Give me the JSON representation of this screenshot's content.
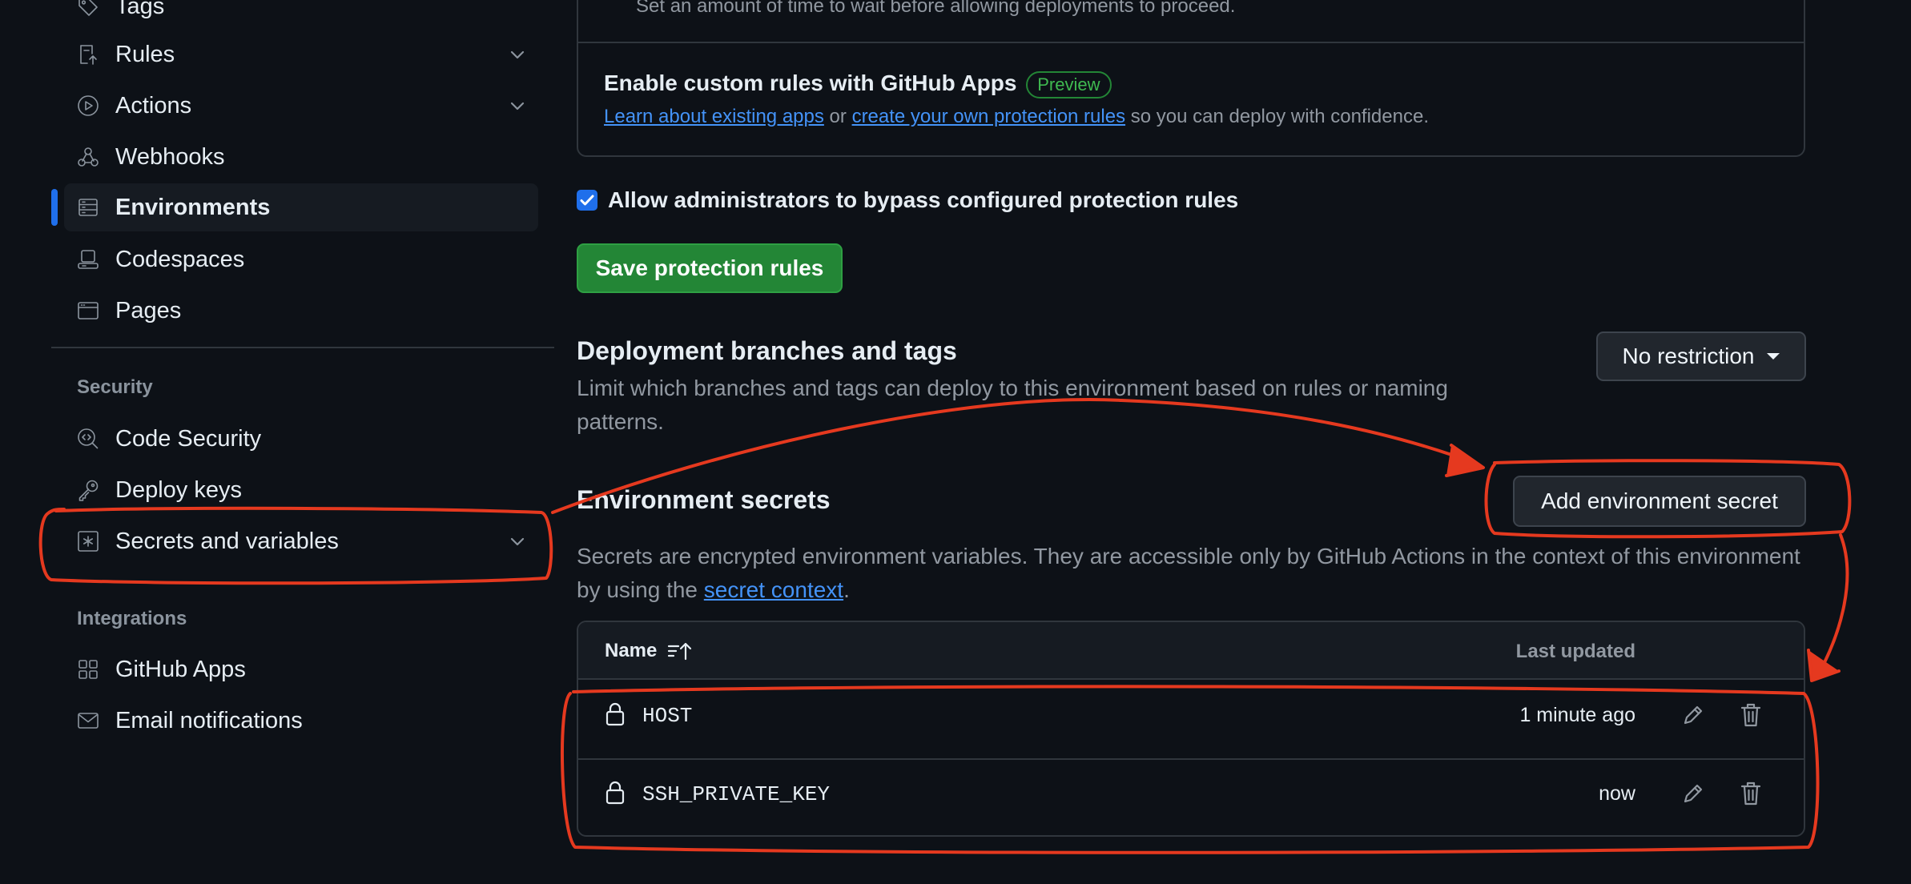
{
  "sidebar": {
    "items_top": [
      {
        "label": "Tags",
        "icon": "tag-icon"
      },
      {
        "label": "Rules",
        "icon": "rules-icon",
        "expandable": true
      },
      {
        "label": "Actions",
        "icon": "play-icon",
        "expandable": true
      },
      {
        "label": "Webhooks",
        "icon": "webhook-icon"
      },
      {
        "label": "Environments",
        "icon": "server-icon",
        "active": true
      },
      {
        "label": "Codespaces",
        "icon": "codespaces-icon"
      },
      {
        "label": "Pages",
        "icon": "browser-icon"
      }
    ],
    "security_heading": "Security",
    "security_items": [
      {
        "label": "Code Security",
        "icon": "codescan-icon"
      },
      {
        "label": "Deploy keys",
        "icon": "key-icon"
      },
      {
        "label": "Secrets and variables",
        "icon": "asterisk-icon",
        "expandable": true
      }
    ],
    "integrations_heading": "Integrations",
    "integration_items": [
      {
        "label": "GitHub Apps",
        "icon": "apps-icon"
      },
      {
        "label": "Email notifications",
        "icon": "mail-icon"
      }
    ]
  },
  "protection": {
    "wait_timer_desc": "Set an amount of time to wait before allowing deployments to proceed.",
    "custom_rules_title": "Enable custom rules with GitHub Apps",
    "preview_badge": "Preview",
    "learn_link": "Learn about existing apps",
    "or_text": " or ",
    "create_link": "create your own protection rules",
    "confidence_text": " so you can deploy with confidence.",
    "bypass_label": "Allow administrators to bypass configured protection rules",
    "bypass_checked": true,
    "save_button": "Save protection rules"
  },
  "deployment_branches": {
    "title": "Deployment branches and tags",
    "description": "Limit which branches and tags can deploy to this environment based on rules or naming patterns.",
    "dropdown_value": "No restriction"
  },
  "env_secrets": {
    "title": "Environment secrets",
    "add_button": "Add environment secret",
    "desc_before": "Secrets are encrypted environment variables. They are accessible only by GitHub Actions in the context of this environment by using the ",
    "secret_context_link": "secret context",
    "desc_after": ".",
    "table": {
      "col_name": "Name",
      "col_updated": "Last updated",
      "rows": [
        {
          "name": "HOST",
          "updated": "1 minute ago"
        },
        {
          "name": "SSH_PRIVATE_KEY",
          "updated": "now"
        }
      ]
    }
  },
  "colors": {
    "background": "#0d1117",
    "accent": "#1f6feb",
    "save_green": "#238636",
    "link": "#4493f8",
    "annotation_red": "#e5391f"
  }
}
